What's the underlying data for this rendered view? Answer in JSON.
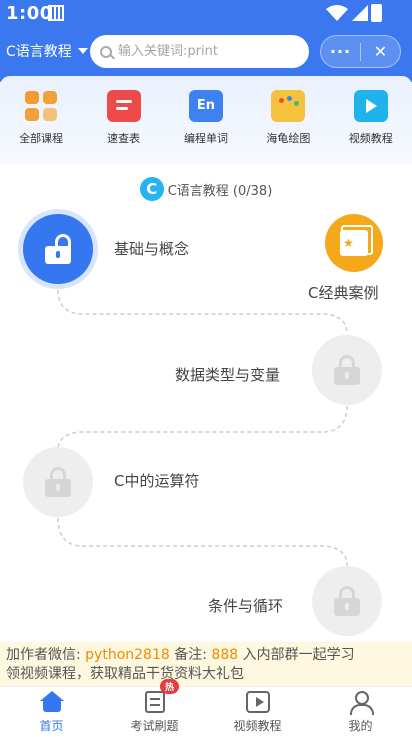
{
  "status_bar": {
    "time": "1:00"
  },
  "header": {
    "language_selector": "C语言教程",
    "search_placeholder": "输入关键词:print",
    "more_label": "···",
    "close_label": "✕"
  },
  "categories": [
    {
      "label": "全部课程",
      "icon": "grid-icon"
    },
    {
      "label": "速查表",
      "icon": "cheatsheet-icon"
    },
    {
      "label": "编程单词",
      "icon": "en-words-icon"
    },
    {
      "label": "海龟绘图",
      "icon": "palette-icon"
    },
    {
      "label": "视频教程",
      "icon": "video-play-icon"
    }
  ],
  "course": {
    "logo": "C",
    "title": "C语言教程 (0/38)"
  },
  "chapters": [
    {
      "label": "基础与概念",
      "state": "unlocked"
    },
    {
      "label": "数据类型与变量",
      "state": "locked"
    },
    {
      "label": "C中的运算符",
      "state": "locked"
    },
    {
      "label": "条件与循环",
      "state": "locked"
    }
  ],
  "case_badge": {
    "label": "C经典案例"
  },
  "promo": {
    "prefix": "加作者微信: ",
    "wechat": "python2818",
    "note_label": " 备注: ",
    "note_code": "888",
    "line1_suffix": " 入内部群一起学习",
    "line2": "领视频课程，获取精品干货资料大礼包"
  },
  "tabs": [
    {
      "label": "首页",
      "active": true
    },
    {
      "label": "考试刷题",
      "badge": "热"
    },
    {
      "label": "视频教程"
    },
    {
      "label": "我的"
    }
  ],
  "colors": {
    "primary": "#3b78f0",
    "accent_orange": "#f6a81b",
    "promo_bg": "#fef8e0"
  }
}
